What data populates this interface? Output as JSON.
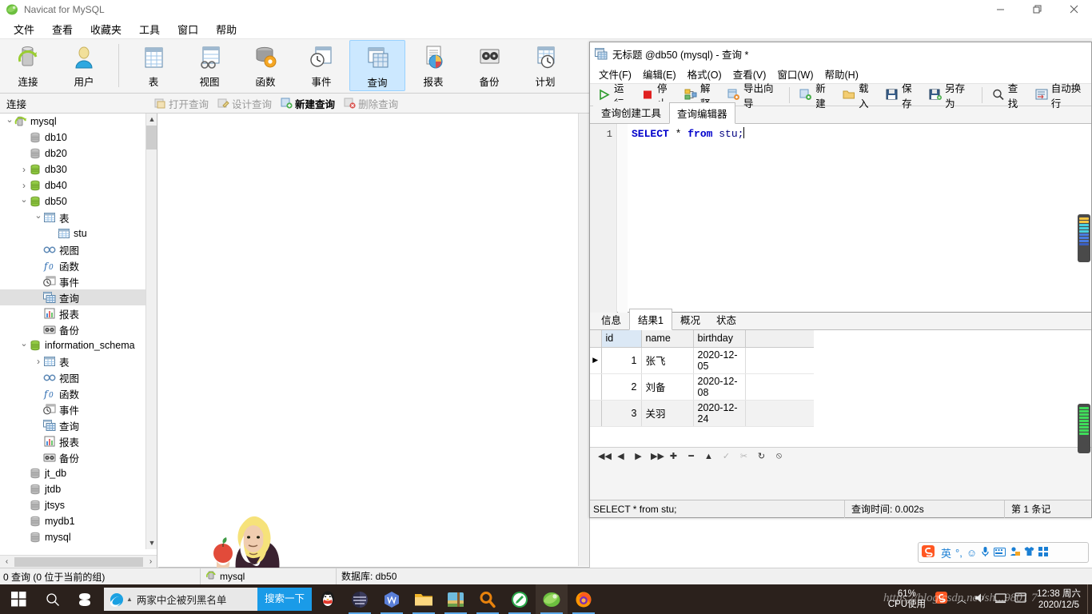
{
  "app": {
    "title": "Navicat for MySQL",
    "window_controls": {
      "minimize": "—",
      "restore": "❐",
      "close": "✕"
    }
  },
  "menubar": {
    "items": [
      "文件",
      "查看",
      "收藏夹",
      "工具",
      "窗口",
      "帮助"
    ]
  },
  "toolbar": {
    "group1": [
      {
        "label": "连接",
        "icon": "connection-icon",
        "active": false
      },
      {
        "label": "用户",
        "icon": "user-icon",
        "active": false
      }
    ],
    "group2": [
      {
        "label": "表",
        "icon": "table-icon",
        "active": false
      },
      {
        "label": "视图",
        "icon": "view-icon",
        "active": false
      },
      {
        "label": "函数",
        "icon": "function-icon",
        "active": false
      },
      {
        "label": "事件",
        "icon": "event-icon",
        "active": false
      },
      {
        "label": "查询",
        "icon": "query-icon",
        "active": true
      },
      {
        "label": "报表",
        "icon": "report-icon",
        "active": false
      },
      {
        "label": "备份",
        "icon": "backup-icon",
        "active": false
      },
      {
        "label": "计划",
        "icon": "schedule-icon",
        "active": false
      }
    ]
  },
  "connbar": {
    "label": "连接",
    "actions": [
      {
        "label": "打开查询",
        "enabled": false
      },
      {
        "label": "设计查询",
        "enabled": false
      },
      {
        "label": "新建查询",
        "enabled": true
      },
      {
        "label": "删除查询",
        "enabled": false
      }
    ]
  },
  "sidebar": {
    "nodes": [
      {
        "label": "mysql",
        "depth": 0,
        "twisty": "v",
        "icon": "server-icon",
        "selected": false
      },
      {
        "label": "db10",
        "depth": 1,
        "twisty": "",
        "icon": "db-gray-icon",
        "selected": false
      },
      {
        "label": "db20",
        "depth": 1,
        "twisty": "",
        "icon": "db-gray-icon",
        "selected": false
      },
      {
        "label": "db30",
        "depth": 1,
        "twisty": ">",
        "icon": "db-green-icon",
        "selected": false
      },
      {
        "label": "db40",
        "depth": 1,
        "twisty": ">",
        "icon": "db-green-icon",
        "selected": false
      },
      {
        "label": "db50",
        "depth": 1,
        "twisty": "v",
        "icon": "db-green-icon",
        "selected": false
      },
      {
        "label": "表",
        "depth": 2,
        "twisty": "v",
        "icon": "table-icon",
        "selected": false
      },
      {
        "label": "stu",
        "depth": 3,
        "twisty": "",
        "icon": "table-icon",
        "selected": false
      },
      {
        "label": "视图",
        "depth": 2,
        "twisty": "",
        "icon": "view-icon",
        "selected": false
      },
      {
        "label": "函数",
        "depth": 2,
        "twisty": "",
        "icon": "function-icon",
        "selected": false
      },
      {
        "label": "事件",
        "depth": 2,
        "twisty": "",
        "icon": "event-icon",
        "selected": false
      },
      {
        "label": "查询",
        "depth": 2,
        "twisty": "",
        "icon": "query-icon",
        "selected": true
      },
      {
        "label": "报表",
        "depth": 2,
        "twisty": "",
        "icon": "report-icon",
        "selected": false
      },
      {
        "label": "备份",
        "depth": 2,
        "twisty": "",
        "icon": "backup-icon",
        "selected": false
      },
      {
        "label": "information_schema",
        "depth": 1,
        "twisty": "v",
        "icon": "db-green-icon",
        "selected": false
      },
      {
        "label": "表",
        "depth": 2,
        "twisty": ">",
        "icon": "table-icon",
        "selected": false
      },
      {
        "label": "视图",
        "depth": 2,
        "twisty": "",
        "icon": "view-icon",
        "selected": false
      },
      {
        "label": "函数",
        "depth": 2,
        "twisty": "",
        "icon": "function-icon",
        "selected": false
      },
      {
        "label": "事件",
        "depth": 2,
        "twisty": "",
        "icon": "event-icon",
        "selected": false
      },
      {
        "label": "查询",
        "depth": 2,
        "twisty": "",
        "icon": "query-icon",
        "selected": false
      },
      {
        "label": "报表",
        "depth": 2,
        "twisty": "",
        "icon": "report-icon",
        "selected": false
      },
      {
        "label": "备份",
        "depth": 2,
        "twisty": "",
        "icon": "backup-icon",
        "selected": false
      },
      {
        "label": "jt_db",
        "depth": 1,
        "twisty": "",
        "icon": "db-gray-icon",
        "selected": false
      },
      {
        "label": "jtdb",
        "depth": 1,
        "twisty": "",
        "icon": "db-gray-icon",
        "selected": false
      },
      {
        "label": "jtsys",
        "depth": 1,
        "twisty": "",
        "icon": "db-gray-icon",
        "selected": false
      },
      {
        "label": "mydb1",
        "depth": 1,
        "twisty": "",
        "icon": "db-gray-icon",
        "selected": false
      },
      {
        "label": "mysql",
        "depth": 1,
        "twisty": "",
        "icon": "db-gray-icon",
        "selected": false
      }
    ]
  },
  "statusbar": {
    "left": "0 查询 (0 位于当前的组)",
    "connection": "mysql",
    "database": "数据库: db50"
  },
  "query_window": {
    "title": "无标题 @db50 (mysql) - 查询 *",
    "menu": [
      "文件(F)",
      "编辑(E)",
      "格式(O)",
      "查看(V)",
      "窗口(W)",
      "帮助(H)"
    ],
    "tools": [
      {
        "label": "运行",
        "icon": "run-icon"
      },
      {
        "label": "停止",
        "icon": "stop-icon"
      },
      {
        "label": "解释",
        "icon": "explain-icon"
      },
      {
        "label": "导出向导",
        "icon": "export-wizard-icon"
      },
      {
        "label": "新建",
        "icon": "new-icon"
      },
      {
        "label": "载入",
        "icon": "load-icon"
      },
      {
        "label": "保存",
        "icon": "save-icon"
      },
      {
        "label": "另存为",
        "icon": "save-as-icon"
      },
      {
        "label": "查找",
        "icon": "search-icon"
      },
      {
        "label": "自动换行",
        "icon": "wordwrap-icon"
      }
    ],
    "tabs": [
      {
        "label": "查询创建工具",
        "active": false
      },
      {
        "label": "查询编辑器",
        "active": true
      }
    ],
    "editor": {
      "line_number": "1",
      "sql_keyword": "SELECT",
      "sql_star": " * ",
      "sql_from": "from",
      "sql_table": " stu;"
    },
    "result_tabs": [
      {
        "label": "信息",
        "active": false
      },
      {
        "label": "结果1",
        "active": true
      },
      {
        "label": "概况",
        "active": false
      },
      {
        "label": "状态",
        "active": false
      }
    ],
    "result_grid": {
      "columns": [
        "id",
        "name",
        "birthday"
      ],
      "rows": [
        {
          "id": "1",
          "name": "张飞",
          "birthday": "2020-12-05"
        },
        {
          "id": "2",
          "name": "刘备",
          "birthday": "2020-12-08"
        },
        {
          "id": "3",
          "name": "关羽",
          "birthday": "2020-12-24"
        }
      ]
    },
    "grid_nav": [
      {
        "icon": "first-record-icon",
        "glyph": "◀◀",
        "dim": false
      },
      {
        "icon": "prev-record-icon",
        "glyph": "◀",
        "dim": false
      },
      {
        "icon": "next-record-icon",
        "glyph": "▶",
        "dim": false
      },
      {
        "icon": "last-record-icon",
        "glyph": "▶▶",
        "dim": false
      },
      {
        "icon": "add-record-icon",
        "glyph": "✚",
        "dim": false
      },
      {
        "icon": "delete-record-icon",
        "glyph": "━",
        "dim": false
      },
      {
        "icon": "apply-record-icon",
        "glyph": "▲",
        "dim": false
      },
      {
        "icon": "confirm-icon",
        "glyph": "✓",
        "dim": true
      },
      {
        "icon": "cancel-edit-icon",
        "glyph": "✂",
        "dim": true
      },
      {
        "icon": "refresh-icon",
        "glyph": "↻",
        "dim": false
      },
      {
        "icon": "stop-loading-icon",
        "glyph": "⦸",
        "dim": false
      }
    ],
    "status": {
      "sql": "SELECT * from stu;",
      "time": "查询时间: 0.002s",
      "record": "第 1 条记"
    }
  },
  "ime": {
    "logo": "S",
    "mode": "英",
    "items": [
      "°,",
      "☺",
      "🎤",
      "⌨",
      "👤",
      "👕",
      "▦"
    ]
  },
  "taskbar": {
    "start": "windows-logo",
    "search_icon": "search-icon",
    "cortana_icon": "cortana-icon",
    "search_box": {
      "value": "两家中企被列黑名单",
      "button": "搜索一下"
    },
    "apps": [
      {
        "icon": "qq-icon",
        "running": false
      },
      {
        "icon": "dark-circle-icon",
        "running": true
      },
      {
        "icon": "wps-icon",
        "running": true
      },
      {
        "icon": "file-explorer-icon",
        "running": true
      },
      {
        "icon": "winrar-icon",
        "running": true
      },
      {
        "icon": "search-orange-icon",
        "running": true
      },
      {
        "icon": "green-pencil-icon",
        "running": true
      },
      {
        "icon": "navicat-icon",
        "running": true,
        "focused": true
      },
      {
        "icon": "firefox-icon",
        "running": true
      }
    ],
    "tray": {
      "cpu_percent": "61%",
      "cpu_label": "CPU使用",
      "sogou": "S",
      "chevron": "︿",
      "volume": "🔊",
      "network": "▭",
      "time": "12:38 周六",
      "date": "2020/12/5"
    }
  },
  "watermark": "https://blog.csdn.net/sh...9801 7",
  "colors": {
    "accent_blue": "#cce8ff",
    "taskbar_bg": "#2b211c",
    "search_btn": "#1a9be8",
    "keyword_blue": "#0000cc",
    "header_key": "#dbe8f5"
  }
}
